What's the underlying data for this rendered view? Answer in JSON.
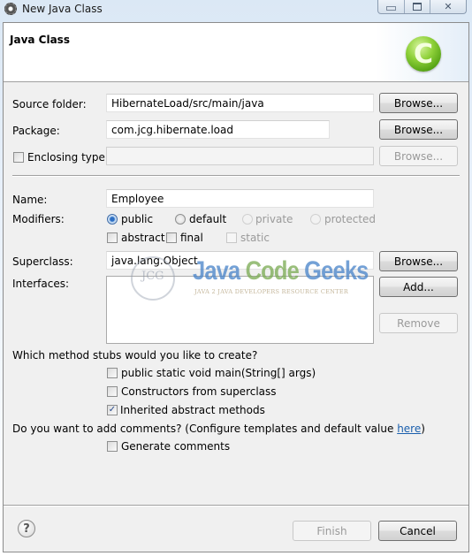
{
  "window": {
    "title": "New Java Class",
    "controls": {
      "minimize": "minimize",
      "maximize": "maximize",
      "close": "close"
    }
  },
  "header": {
    "title": "Java Class",
    "icon": "java-class-icon"
  },
  "fields": {
    "source_folder": {
      "label": "Source folder:",
      "value": "HibernateLoad/src/main/java",
      "button": "Browse..."
    },
    "package": {
      "label": "Package:",
      "value": "com.jcg.hibernate.load",
      "button": "Browse..."
    },
    "enclosing_type": {
      "label": "Enclosing type:",
      "value": "",
      "checked": false,
      "button": "Browse..."
    },
    "name": {
      "label": "Name:",
      "value": "Employee"
    },
    "modifiers": {
      "label": "Modifiers:",
      "radios": [
        {
          "label": "public",
          "selected": true,
          "enabled": true
        },
        {
          "label": "default",
          "selected": false,
          "enabled": true
        },
        {
          "label": "private",
          "selected": false,
          "enabled": false
        },
        {
          "label": "protected",
          "selected": false,
          "enabled": false
        }
      ],
      "checks": [
        {
          "label": "abstract",
          "checked": false,
          "enabled": true
        },
        {
          "label": "final",
          "checked": false,
          "enabled": true
        },
        {
          "label": "static",
          "checked": false,
          "enabled": false
        }
      ]
    },
    "superclass": {
      "label": "Superclass:",
      "value": "java.lang.Object",
      "button": "Browse..."
    },
    "interfaces": {
      "label": "Interfaces:",
      "items": [],
      "add_button": "Add...",
      "remove_button": "Remove"
    }
  },
  "stubs": {
    "question": "Which method stubs would you like to create?",
    "options": [
      {
        "label": "public static void main(String[] args)",
        "checked": false
      },
      {
        "label": "Constructors from superclass",
        "checked": false
      },
      {
        "label": "Inherited abstract methods",
        "checked": true
      }
    ]
  },
  "comments": {
    "question_prefix": "Do you want to add comments? (Configure templates and default value ",
    "link": "here",
    "question_suffix": ")",
    "option": {
      "label": "Generate comments",
      "checked": false
    }
  },
  "watermark": {
    "logo": "JCG",
    "word1": "Java",
    "word2": "Code",
    "word3": "Geeks",
    "subtitle": "JAVA 2 JAVA DEVELOPERS RESOURCE CENTER"
  },
  "footer": {
    "finish": "Finish",
    "cancel": "Cancel",
    "help_icon": "?"
  }
}
